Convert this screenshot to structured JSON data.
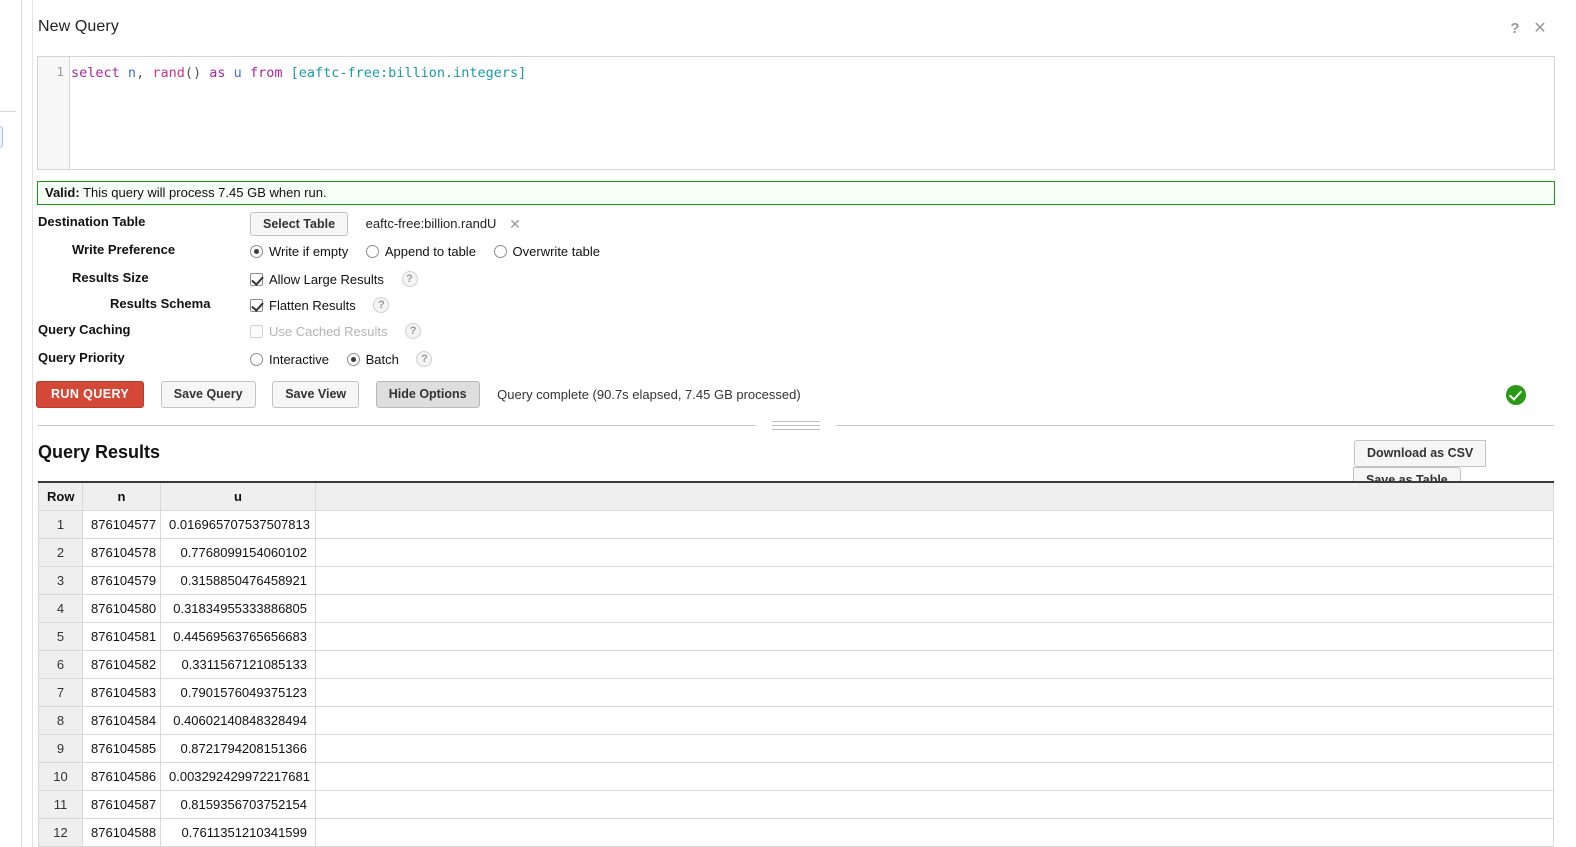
{
  "panel": {
    "title": "New Query",
    "help_icon": "question-mark-icon",
    "close_icon": "close-x-icon"
  },
  "editor": {
    "line_number": "1",
    "tokens": [
      {
        "text": "select",
        "type": "keyword"
      },
      {
        "text": " ",
        "type": "plain"
      },
      {
        "text": "n",
        "type": "identifier"
      },
      {
        "text": ", ",
        "type": "punctuation"
      },
      {
        "text": "rand",
        "type": "function"
      },
      {
        "text": "()",
        "type": "punctuation"
      },
      {
        "text": " ",
        "type": "plain"
      },
      {
        "text": "as",
        "type": "keyword"
      },
      {
        "text": " ",
        "type": "plain"
      },
      {
        "text": "u",
        "type": "identifier"
      },
      {
        "text": " ",
        "type": "plain"
      },
      {
        "text": "from",
        "type": "keyword"
      },
      {
        "text": " ",
        "type": "plain"
      },
      {
        "text": "[eaftc-free:billion.integers]",
        "type": "table"
      }
    ],
    "full_text": "select n, rand() as u from [eaftc-free:billion.integers]"
  },
  "validation": {
    "label": "Valid:",
    "message": "This query will process 7.45 GB when run.",
    "border_color": "#11a011",
    "background_color": "#f6fff6"
  },
  "options": {
    "destination_table": {
      "label": "Destination Table",
      "select_button": "Select Table",
      "value": "eaftc-free:billion.randU",
      "clear_icon": "close-x-icon"
    },
    "write_preference": {
      "label": "Write Preference",
      "choices": [
        {
          "label": "Write if empty",
          "selected": true
        },
        {
          "label": "Append to table",
          "selected": false
        },
        {
          "label": "Overwrite table",
          "selected": false
        }
      ]
    },
    "results_size": {
      "label": "Results Size",
      "checkbox_label": "Allow Large Results",
      "checked": true,
      "disabled": false,
      "help": "?"
    },
    "results_schema": {
      "label": "Results Schema",
      "checkbox_label": "Flatten Results",
      "checked": true,
      "disabled": false,
      "help": "?"
    },
    "query_caching": {
      "label": "Query Caching",
      "checkbox_label": "Use Cached Results",
      "checked": false,
      "disabled": true,
      "help": "?"
    },
    "query_priority": {
      "label": "Query Priority",
      "choices": [
        {
          "label": "Interactive",
          "selected": false
        },
        {
          "label": "Batch",
          "selected": true
        }
      ],
      "help": "?"
    }
  },
  "actions": {
    "run_query": "RUN QUERY",
    "save_query": "Save Query",
    "save_view": "Save View",
    "hide_options": "Hide Options",
    "status": "Query complete (90.7s elapsed, 7.45 GB processed)",
    "status_icon": "green-check-circle-icon",
    "run_query_color": "#d34836",
    "status_icon_color": "#2a9a16"
  },
  "results": {
    "title": "Query Results",
    "download_csv": "Download as CSV",
    "save_as_table": "Save as Table",
    "columns": [
      "Row",
      "n",
      "u",
      ""
    ],
    "rows": [
      {
        "row": "1",
        "n": "876104577",
        "u": "0.016965707537507813"
      },
      {
        "row": "2",
        "n": "876104578",
        "u": "0.7768099154060102"
      },
      {
        "row": "3",
        "n": "876104579",
        "u": "0.3158850476458921"
      },
      {
        "row": "4",
        "n": "876104580",
        "u": "0.31834955333886805"
      },
      {
        "row": "5",
        "n": "876104581",
        "u": "0.44569563765656683"
      },
      {
        "row": "6",
        "n": "876104582",
        "u": "0.3311567121085133"
      },
      {
        "row": "7",
        "n": "876104583",
        "u": "0.7901576049375123"
      },
      {
        "row": "8",
        "n": "876104584",
        "u": "0.40602140848328494"
      },
      {
        "row": "9",
        "n": "876104585",
        "u": "0.8721794208151366"
      },
      {
        "row": "10",
        "n": "876104586",
        "u": "0.003292429972217681"
      },
      {
        "row": "11",
        "n": "876104587",
        "u": "0.8159356703752154"
      },
      {
        "row": "12",
        "n": "876104588",
        "u": "0.7611351210341599"
      }
    ]
  }
}
